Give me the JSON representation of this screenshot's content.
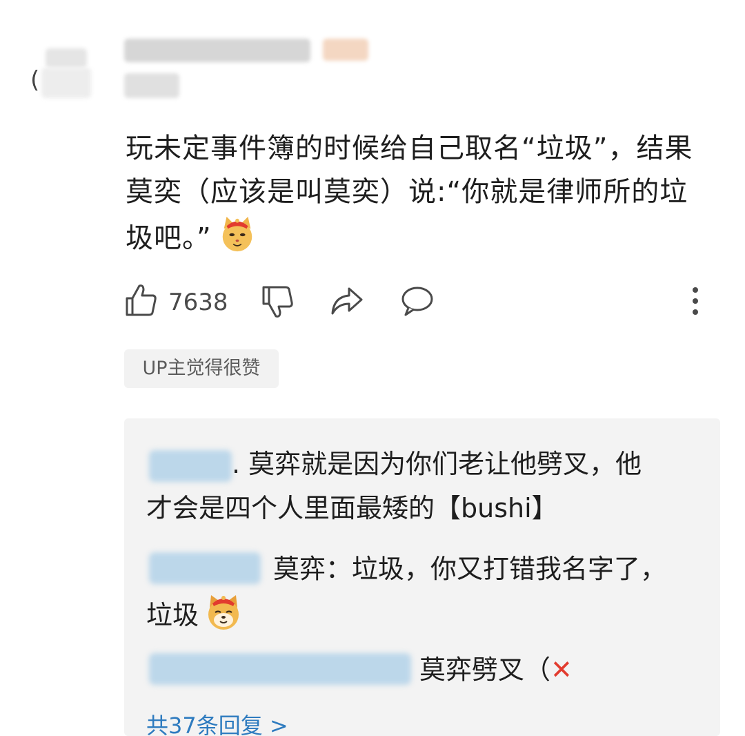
{
  "comment": {
    "text": "玩未定事件簿的时候给自己取名“垃圾”，结果莫奕（应该是叫莫奕）说:“你就是律师所的垃圾吧。”",
    "like_count": "7638",
    "badge": "UP主觉得很赞"
  },
  "icons": [
    "thumbs-up-icon",
    "thumbs-down-icon",
    "share-icon",
    "comment-icon",
    "more-icon",
    "cat-emoji-icon",
    "dog-emoji-icon",
    "cross-mark-icon"
  ],
  "replies": [
    {
      "text": ". 莫弈就是因为你们老让他劈叉，他才会是四个人里面最矮的【bushi】"
    },
    {
      "text": "莫弈：垃圾，你又打错我名字了，垃圾"
    },
    {
      "text": "莫弈劈叉（"
    }
  ],
  "replies_link": "共37条回复 >",
  "colors": {
    "link": "#2e7bbf",
    "cross": "#e23b2e",
    "reply_bg": "#f3f3f3"
  }
}
